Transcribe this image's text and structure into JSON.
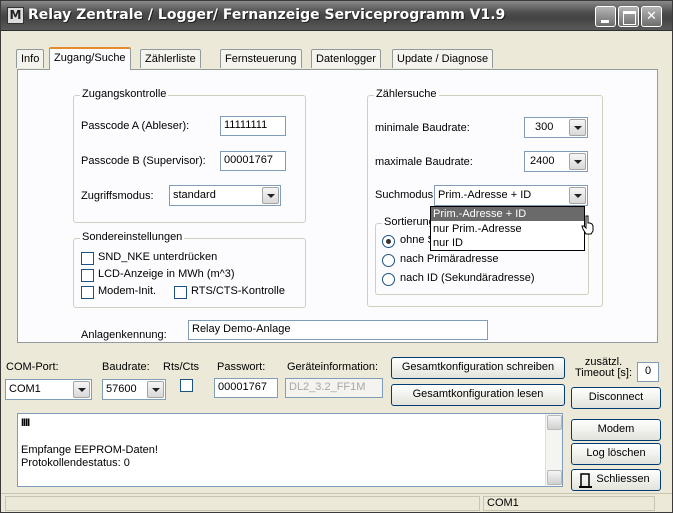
{
  "window": {
    "title": "Relay Zentrale / Logger/ Fernanzeige Serviceprogramm  V1.9",
    "app_icon_glyph": "M"
  },
  "tabs": [
    {
      "label": "Info",
      "active": false
    },
    {
      "label": "Zugang/Suche",
      "active": true
    },
    {
      "label": "Zählerliste",
      "active": false
    },
    {
      "label": "Fernsteuerung",
      "active": false
    },
    {
      "label": "Datenlogger",
      "active": false
    },
    {
      "label": "Update / Diagnose",
      "active": false
    }
  ],
  "zugangskontrolle": {
    "legend": "Zugangskontrolle",
    "passcode_a_label": "Passcode A (Ableser):",
    "passcode_a_value": "11111111",
    "passcode_b_label": "Passcode B (Supervisor):",
    "passcode_b_value": "00001767",
    "zugriffsmodus_label": "Zugriffsmodus:",
    "zugriffsmodus_value": "standard"
  },
  "sondereinstellungen": {
    "legend": "Sondereinstellungen",
    "snd_nke": "SND_NKE unterdrücken",
    "lcd": "LCD-Anzeige in MWh (m^3)",
    "modem_init": "Modem-Init.",
    "rts_cts": "RTS/CTS-Kontrolle"
  },
  "zaehlersuche": {
    "legend": "Zählersuche",
    "min_baud_label": "minimale Baudrate:",
    "min_baud_value": "300",
    "max_baud_label": "maximale Baudrate:",
    "max_baud_value": "2400",
    "suchmodus_label": "Suchmodus:",
    "suchmodus_value": "Prim.-Adresse + ID",
    "suchmodus_options": [
      "Prim.-Adresse + ID",
      "nur Prim.-Adresse",
      "nur ID"
    ],
    "sortierung_legend": "Sortierung der Suche",
    "sort_options": [
      "ohne Sortierung",
      "nach Primäradresse",
      "nach ID (Sekundäradresse)"
    ],
    "sort_selected": 0
  },
  "anlagenkennung": {
    "label": "Anlagenkennung:",
    "value": "Relay Demo-Anlage"
  },
  "bottom": {
    "com_port_label": "COM-Port:",
    "com_port_value": "COM1",
    "baudrate_label": "Baudrate:",
    "baudrate_value": "57600",
    "rts_cts_label": "Rts/Cts",
    "passwort_label": "Passwort:",
    "passwort_value": "00001767",
    "geraeteinfo_label": "Geräteinformation:",
    "geraeteinfo_value": "DL2_3.2_FF1M",
    "write_config_button": "Gesamtkonfiguration schreiben",
    "read_config_button": "Gesamtkonfiguration lesen",
    "timeout_label": "zusätzl. Timeout [s]:",
    "timeout_value": "0",
    "disconnect_button": "Disconnect",
    "modem_button": "Modem",
    "log_clear_button": "Log löschen",
    "close_button": "Schliessen"
  },
  "log": {
    "progress_marks": "IIII",
    "lines": [
      "Empfange EEPROM-Daten!",
      "Protokollendestatus: 0"
    ]
  },
  "statusbar": {
    "port": "COM1"
  }
}
